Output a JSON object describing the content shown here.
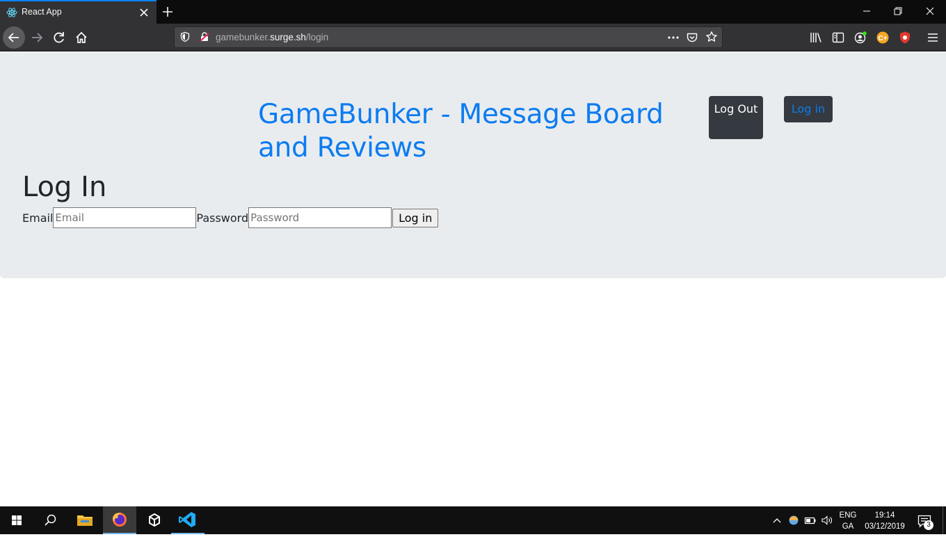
{
  "browser": {
    "tab_title": "React App",
    "url_prefix": "gamebunker.",
    "url_domain": "surge.sh",
    "url_path": "/login"
  },
  "header": {
    "site_title": "GameBunker - Message Board and Reviews",
    "logout_label": "Log Out",
    "login_label": "Log in"
  },
  "login_form": {
    "heading": "Log In",
    "email_label": "Email",
    "email_placeholder": "Email",
    "email_value": "",
    "password_label": "Password",
    "password_placeholder": "Password",
    "password_value": "",
    "submit_label": "Log in"
  },
  "taskbar": {
    "lang_line1": "ENG",
    "lang_line2": "GA",
    "time": "19:14",
    "date": "03/12/2019",
    "notification_count": "3"
  },
  "colors": {
    "link_blue": "#0c7cf1",
    "jumbotron_bg": "#e9ecef",
    "dark_button": "#343a40"
  }
}
